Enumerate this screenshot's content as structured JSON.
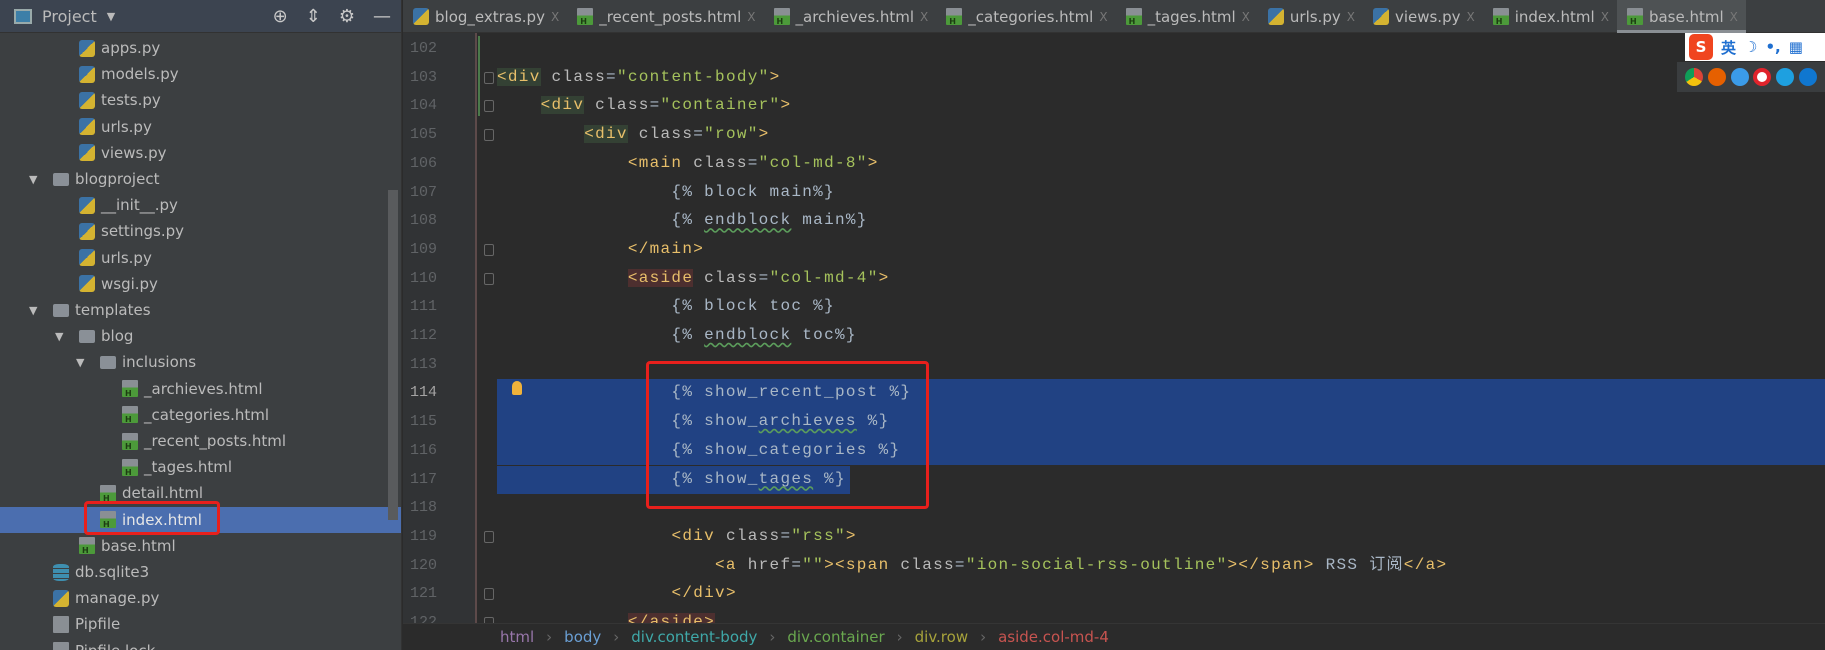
{
  "sidebar": {
    "title": "Project",
    "tree": [
      {
        "label": "apps.py",
        "type": "py",
        "level": 1
      },
      {
        "label": "models.py",
        "type": "py",
        "level": 1
      },
      {
        "label": "tests.py",
        "type": "py",
        "level": 1
      },
      {
        "label": "urls.py",
        "type": "py",
        "level": 1
      },
      {
        "label": "views.py",
        "type": "py",
        "level": 1
      },
      {
        "label": "blogproject",
        "type": "folder",
        "level": 0,
        "expanded": true
      },
      {
        "label": "__init__.py",
        "type": "py",
        "level": 1
      },
      {
        "label": "settings.py",
        "type": "py",
        "level": 1
      },
      {
        "label": "urls.py",
        "type": "py",
        "level": 1
      },
      {
        "label": "wsgi.py",
        "type": "py",
        "level": 1
      },
      {
        "label": "templates",
        "type": "folder",
        "level": 0,
        "expanded": true
      },
      {
        "label": "blog",
        "type": "folder",
        "level": 1,
        "expanded": true
      },
      {
        "label": "inclusions",
        "type": "folder",
        "level": 2,
        "expanded": true
      },
      {
        "label": "_archieves.html",
        "type": "html",
        "level": 3
      },
      {
        "label": "_categories.html",
        "type": "html",
        "level": 3
      },
      {
        "label": "_recent_posts.html",
        "type": "html",
        "level": 3
      },
      {
        "label": "_tages.html",
        "type": "html",
        "level": 3
      },
      {
        "label": "detail.html",
        "type": "html",
        "level": 2
      },
      {
        "label": "index.html",
        "type": "html",
        "level": 2,
        "selected": true
      },
      {
        "label": "base.html",
        "type": "html",
        "level": 1
      },
      {
        "label": "db.sqlite3",
        "type": "db",
        "level": 0
      },
      {
        "label": "manage.py",
        "type": "py",
        "level": 0
      },
      {
        "label": "Pipfile",
        "type": "txt",
        "level": 0
      },
      {
        "label": "Pipfile.lock",
        "type": "txt",
        "level": 0
      }
    ]
  },
  "tabs": [
    {
      "label": "blog_extras.py",
      "type": "py"
    },
    {
      "label": "_recent_posts.html",
      "type": "html"
    },
    {
      "label": "_archieves.html",
      "type": "html"
    },
    {
      "label": "_categories.html",
      "type": "html"
    },
    {
      "label": "_tages.html",
      "type": "html"
    },
    {
      "label": "urls.py",
      "type": "py"
    },
    {
      "label": "views.py",
      "type": "py"
    },
    {
      "label": "index.html",
      "type": "html"
    },
    {
      "label": "base.html",
      "type": "html",
      "active": true
    }
  ],
  "editor": {
    "current_line": 114,
    "lines": [
      {
        "n": "102",
        "seg": []
      },
      {
        "n": "103",
        "seg": [
          {
            "t": "<div",
            "c": "tag hl-g"
          },
          {
            "t": " class",
            "c": "attr"
          },
          {
            "t": "=",
            "c": "txt"
          },
          {
            "t": "\"content-body\"",
            "c": "str"
          },
          {
            "t": ">",
            "c": "tag"
          }
        ]
      },
      {
        "n": "104",
        "seg": [
          {
            "t": "    ",
            "c": "txt"
          },
          {
            "t": "<div",
            "c": "tag hl-g"
          },
          {
            "t": " class",
            "c": "attr"
          },
          {
            "t": "=",
            "c": "txt"
          },
          {
            "t": "\"container\"",
            "c": "str"
          },
          {
            "t": ">",
            "c": "tag"
          }
        ]
      },
      {
        "n": "105",
        "seg": [
          {
            "t": "        ",
            "c": "txt"
          },
          {
            "t": "<div",
            "c": "tag hl-g"
          },
          {
            "t": " class",
            "c": "attr"
          },
          {
            "t": "=",
            "c": "txt"
          },
          {
            "t": "\"row\"",
            "c": "str"
          },
          {
            "t": ">",
            "c": "tag"
          }
        ]
      },
      {
        "n": "106",
        "seg": [
          {
            "t": "            ",
            "c": "txt"
          },
          {
            "t": "<main",
            "c": "tag"
          },
          {
            "t": " class",
            "c": "attr"
          },
          {
            "t": "=",
            "c": "txt"
          },
          {
            "t": "\"col-md-8\"",
            "c": "str"
          },
          {
            "t": ">",
            "c": "tag"
          }
        ]
      },
      {
        "n": "107",
        "seg": [
          {
            "t": "                {% block main%}",
            "c": "tpl"
          }
        ]
      },
      {
        "n": "108",
        "seg": [
          {
            "t": "                {% ",
            "c": "tpl"
          },
          {
            "t": "endblock",
            "c": "tpl wavy"
          },
          {
            "t": " main%}",
            "c": "tpl"
          }
        ]
      },
      {
        "n": "109",
        "seg": [
          {
            "t": "            ",
            "c": "txt"
          },
          {
            "t": "</main>",
            "c": "tag"
          }
        ]
      },
      {
        "n": "110",
        "seg": [
          {
            "t": "            ",
            "c": "txt"
          },
          {
            "t": "<aside",
            "c": "tag hl-r"
          },
          {
            "t": " class",
            "c": "attr"
          },
          {
            "t": "=",
            "c": "txt"
          },
          {
            "t": "\"col-md-4\"",
            "c": "str"
          },
          {
            "t": ">",
            "c": "tag"
          }
        ]
      },
      {
        "n": "111",
        "seg": [
          {
            "t": "                {% block toc %}",
            "c": "tpl"
          }
        ]
      },
      {
        "n": "112",
        "seg": [
          {
            "t": "                {% ",
            "c": "tpl"
          },
          {
            "t": "endblock",
            "c": "tpl wavy"
          },
          {
            "t": " toc%}",
            "c": "tpl"
          }
        ]
      },
      {
        "n": "113",
        "seg": []
      },
      {
        "n": "114",
        "seg": [
          {
            "t": "                {% show_recent_post %}",
            "c": "tpl"
          }
        ]
      },
      {
        "n": "115",
        "seg": [
          {
            "t": "                {% show_",
            "c": "tpl"
          },
          {
            "t": "archieves",
            "c": "tpl wavy"
          },
          {
            "t": " %}",
            "c": "tpl"
          }
        ]
      },
      {
        "n": "116",
        "seg": [
          {
            "t": "                {% show_categories %}",
            "c": "tpl"
          }
        ]
      },
      {
        "n": "117",
        "seg": [
          {
            "t": "                {% show_",
            "c": "tpl"
          },
          {
            "t": "tages",
            "c": "tpl wavy"
          },
          {
            "t": " %}",
            "c": "tpl"
          }
        ]
      },
      {
        "n": "118",
        "seg": []
      },
      {
        "n": "119",
        "seg": [
          {
            "t": "                ",
            "c": "txt"
          },
          {
            "t": "<div",
            "c": "tag"
          },
          {
            "t": " class",
            "c": "attr"
          },
          {
            "t": "=",
            "c": "txt"
          },
          {
            "t": "\"rss\"",
            "c": "str"
          },
          {
            "t": ">",
            "c": "tag"
          }
        ]
      },
      {
        "n": "120",
        "seg": [
          {
            "t": "                    ",
            "c": "txt"
          },
          {
            "t": "<a",
            "c": "tag"
          },
          {
            "t": " href",
            "c": "attr"
          },
          {
            "t": "=",
            "c": "txt"
          },
          {
            "t": "\"\"",
            "c": "str"
          },
          {
            "t": "><span",
            "c": "tag"
          },
          {
            "t": " class",
            "c": "attr"
          },
          {
            "t": "=",
            "c": "txt"
          },
          {
            "t": "\"ion-social-rss-outline\"",
            "c": "str"
          },
          {
            "t": "></span>",
            "c": "tag"
          },
          {
            "t": " RSS 订阅",
            "c": "txt"
          },
          {
            "t": "</a>",
            "c": "tag"
          }
        ]
      },
      {
        "n": "121",
        "seg": [
          {
            "t": "                ",
            "c": "txt"
          },
          {
            "t": "</div>",
            "c": "tag"
          }
        ]
      },
      {
        "n": "122",
        "seg": [
          {
            "t": "            ",
            "c": "txt"
          },
          {
            "t": "</aside>",
            "c": "tag hl-r"
          }
        ]
      }
    ]
  },
  "breadcrumb": [
    {
      "label": "html",
      "color": "#9876aa"
    },
    {
      "label": "body",
      "color": "#6a9fd4"
    },
    {
      "label": "div.content-body",
      "color": "#3fa8a8"
    },
    {
      "label": "div.container",
      "color": "#6aa84f"
    },
    {
      "label": "div.row",
      "color": "#a7a33b"
    },
    {
      "label": "aside.col-md-4",
      "color": "#c75450"
    }
  ],
  "ime": {
    "lang": "英"
  }
}
